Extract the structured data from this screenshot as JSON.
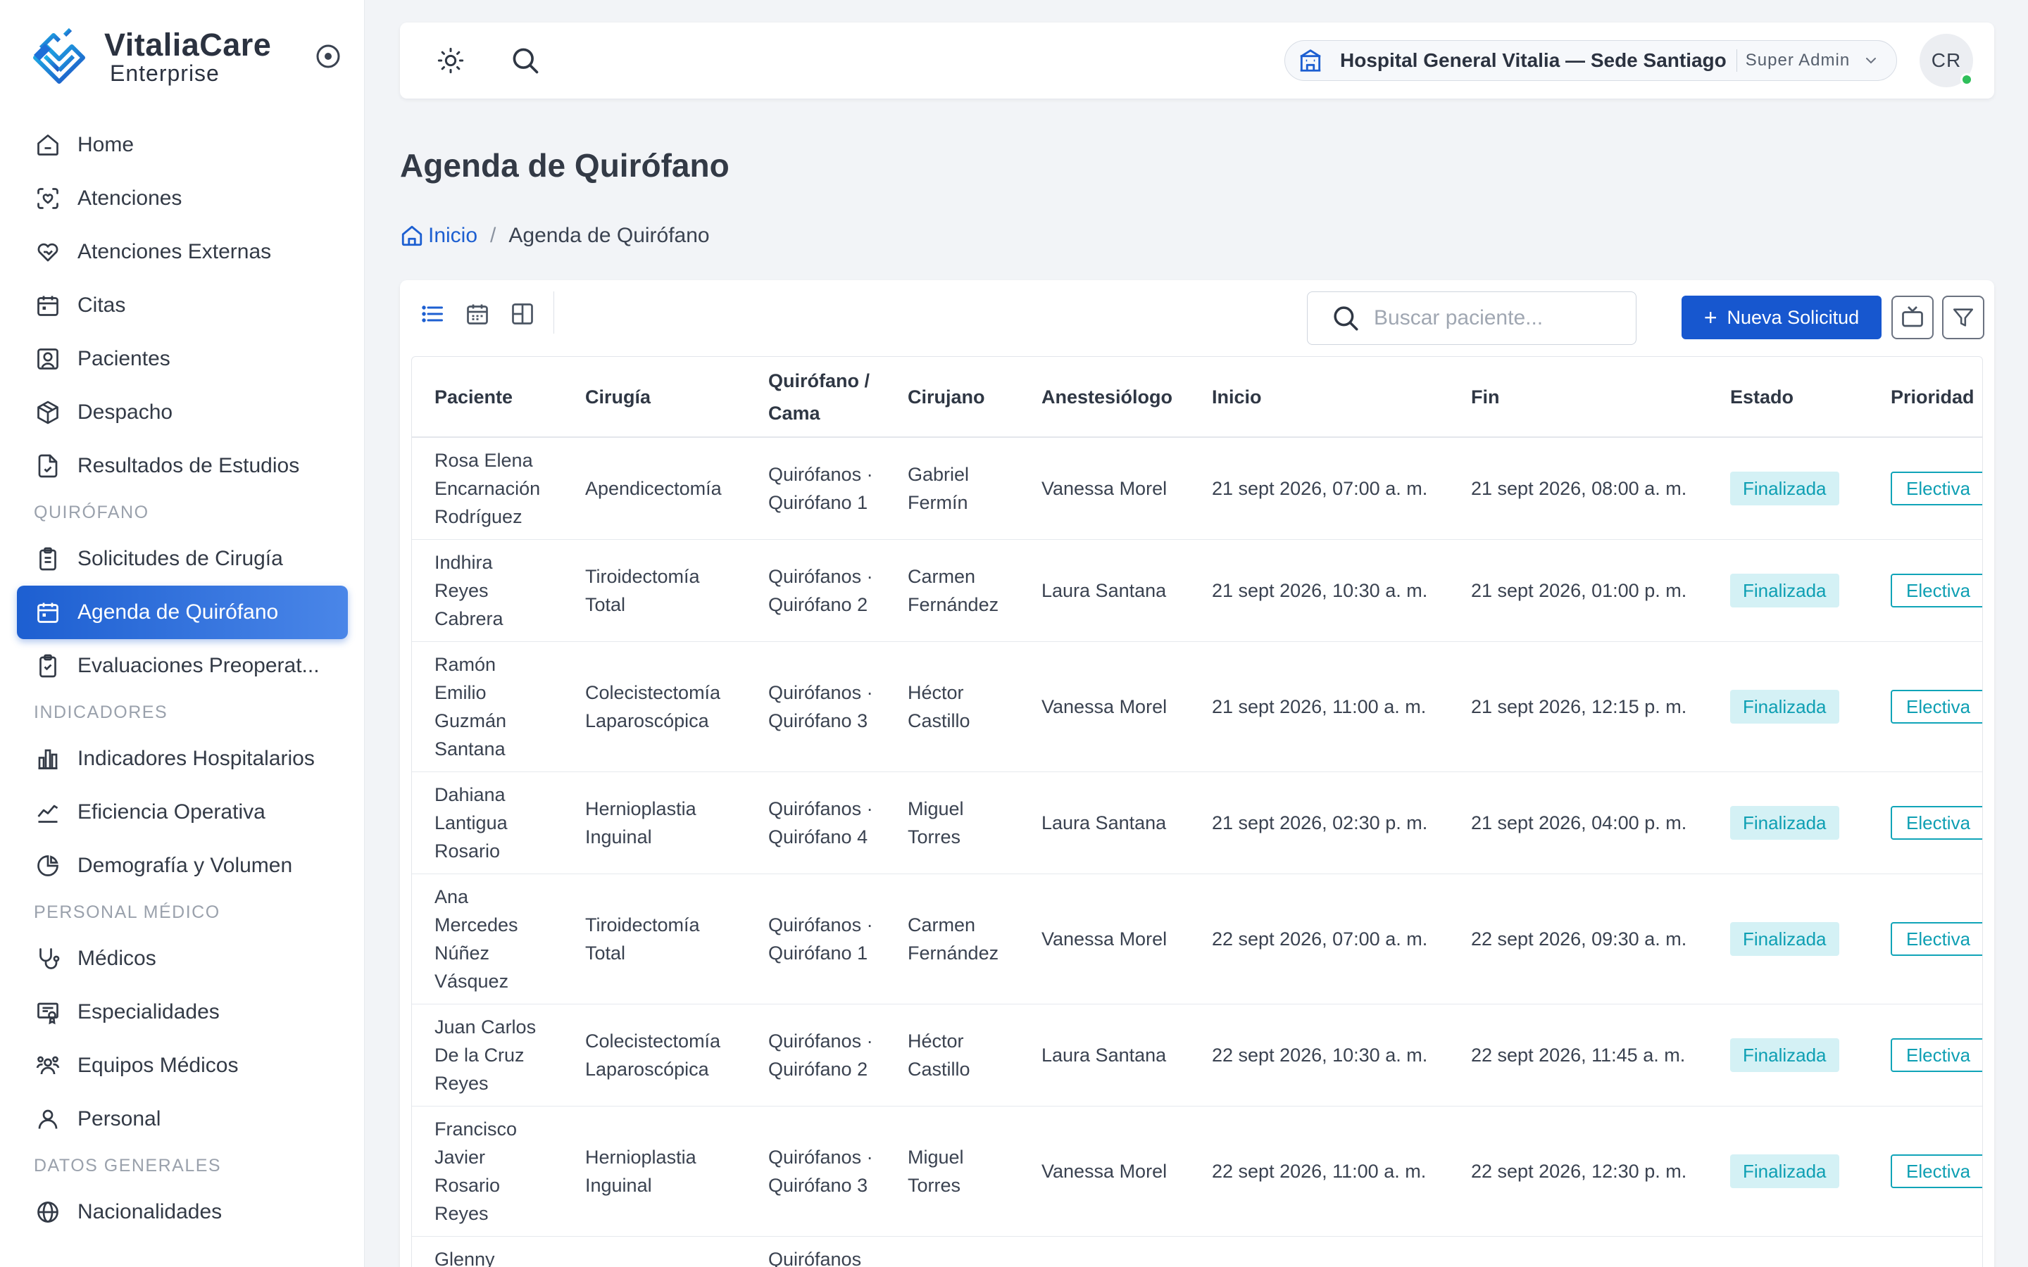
{
  "brand": {
    "name": "VitaliaCare",
    "subtitle": "Enterprise"
  },
  "sidebar": {
    "items": [
      {
        "label": "Home",
        "icon": "home-icon"
      },
      {
        "label": "Atenciones",
        "icon": "scan-heart-icon"
      },
      {
        "label": "Atenciones Externas",
        "icon": "hand-heart-icon"
      },
      {
        "label": "Citas",
        "icon": "calendar-icon"
      },
      {
        "label": "Pacientes",
        "icon": "user-square-icon"
      },
      {
        "label": "Despacho",
        "icon": "package-icon"
      },
      {
        "label": "Resultados de Estudios",
        "icon": "file-check-icon"
      }
    ],
    "section_quirofano": "QUIRÓFANO",
    "quirofano_items": [
      {
        "label": "Solicitudes de Cirugía",
        "icon": "clipboard-icon"
      },
      {
        "label": "Agenda de Quirófano",
        "icon": "calendar-icon",
        "active": true
      },
      {
        "label": "Evaluaciones Preoperat...",
        "icon": "clipboard-check-icon"
      }
    ],
    "section_indicadores": "INDICADORES",
    "indicadores_items": [
      {
        "label": "Indicadores Hospitalarios",
        "icon": "bar-chart-icon"
      },
      {
        "label": "Eficiencia Operativa",
        "icon": "line-chart-icon"
      },
      {
        "label": "Demografía y Volumen",
        "icon": "pie-chart-icon"
      }
    ],
    "section_personal": "PERSONAL MÉDICO",
    "personal_items": [
      {
        "label": "Médicos",
        "icon": "stethoscope-icon"
      },
      {
        "label": "Especialidades",
        "icon": "certificate-icon"
      },
      {
        "label": "Equipos Médicos",
        "icon": "users-icon"
      },
      {
        "label": "Personal",
        "icon": "user-icon"
      }
    ],
    "section_datos": "DATOS GENERALES",
    "datos_items": [
      {
        "label": "Nacionalidades",
        "icon": "globe-icon"
      }
    ]
  },
  "topbar": {
    "hospital": "Hospital General Vitalia — Sede Santiago",
    "role": "Super Admin",
    "avatar_initials": "CR",
    "status_color": "#2fbf5a"
  },
  "page": {
    "title": "Agenda de Quirófano",
    "breadcrumb_home": "Inicio",
    "breadcrumb_current": "Agenda de Quirófano"
  },
  "toolbar": {
    "search_placeholder": "Buscar paciente...",
    "new_button": "Nueva Solicitud"
  },
  "table": {
    "headers": {
      "paciente": "Paciente",
      "cirugia": "Cirugía",
      "quirofano": "Quirófano / Cama",
      "cirujano": "Cirujano",
      "anestesiologo": "Anestesiólogo",
      "inicio": "Inicio",
      "fin": "Fin",
      "estado": "Estado",
      "prioridad": "Prioridad"
    },
    "rows": [
      {
        "paciente": "Rosa Elena Encarnación Rodríguez",
        "cirugia": "Apendicectomía",
        "quirofano": "Quirófanos · Quirófano 1",
        "cirujano": "Gabriel Fermín",
        "anestesiologo": "Vanessa Morel",
        "inicio": "21 sept 2026, 07:00 a. m.",
        "fin": "21 sept 2026, 08:00 a. m.",
        "estado": "Finalizada",
        "prioridad": "Electiva"
      },
      {
        "paciente": "Indhira Reyes Cabrera",
        "cirugia": "Tiroidectomía Total",
        "quirofano": "Quirófanos · Quirófano 2",
        "cirujano": "Carmen Fernández",
        "anestesiologo": "Laura Santana",
        "inicio": "21 sept 2026, 10:30 a. m.",
        "fin": "21 sept 2026, 01:00 p. m.",
        "estado": "Finalizada",
        "prioridad": "Electiva"
      },
      {
        "paciente": "Ramón Emilio Guzmán Santana",
        "cirugia": "Colecistectomía Laparoscópica",
        "quirofano": "Quirófanos · Quirófano 3",
        "cirujano": "Héctor Castillo",
        "anestesiologo": "Vanessa Morel",
        "inicio": "21 sept 2026, 11:00 a. m.",
        "fin": "21 sept 2026, 12:15 p. m.",
        "estado": "Finalizada",
        "prioridad": "Electiva"
      },
      {
        "paciente": "Dahiana Lantigua Rosario",
        "cirugia": "Hernioplastia Inguinal",
        "quirofano": "Quirófanos · Quirófano 4",
        "cirujano": "Miguel Torres",
        "anestesiologo": "Laura Santana",
        "inicio": "21 sept 2026, 02:30 p. m.",
        "fin": "21 sept 2026, 04:00 p. m.",
        "estado": "Finalizada",
        "prioridad": "Electiva"
      },
      {
        "paciente": "Ana Mercedes Núñez Vásquez",
        "cirugia": "Tiroidectomía Total",
        "quirofano": "Quirófanos · Quirófano 1",
        "cirujano": "Carmen Fernández",
        "anestesiologo": "Vanessa Morel",
        "inicio": "22 sept 2026, 07:00 a. m.",
        "fin": "22 sept 2026, 09:30 a. m.",
        "estado": "Finalizada",
        "prioridad": "Electiva"
      },
      {
        "paciente": "Juan Carlos De la Cruz Reyes",
        "cirugia": "Colecistectomía Laparoscópica",
        "quirofano": "Quirófanos · Quirófano 2",
        "cirujano": "Héctor Castillo",
        "anestesiologo": "Laura Santana",
        "inicio": "22 sept 2026, 10:30 a. m.",
        "fin": "22 sept 2026, 11:45 a. m.",
        "estado": "Finalizada",
        "prioridad": "Electiva"
      },
      {
        "paciente": "Francisco Javier Rosario Reyes",
        "cirugia": "Hernioplastia Inguinal",
        "quirofano": "Quirófanos · Quirófano 3",
        "cirujano": "Miguel Torres",
        "anestesiologo": "Vanessa Morel",
        "inicio": "22 sept 2026, 11:00 a. m.",
        "fin": "22 sept 2026, 12:30 p. m.",
        "estado": "Finalizada",
        "prioridad": "Electiva"
      },
      {
        "paciente": "Glenny",
        "cirugia": "",
        "quirofano": "Quirófanos",
        "cirujano": "",
        "anestesiologo": "",
        "inicio": "",
        "fin": "",
        "estado": "",
        "prioridad": ""
      }
    ]
  },
  "colors": {
    "accent": "#1757cf",
    "status_badge_bg": "#d4f1f5",
    "status_badge_text": "#0e9fb3",
    "sidebar_active_start": "#1d5fd1",
    "sidebar_active_end": "#4a86e8"
  }
}
